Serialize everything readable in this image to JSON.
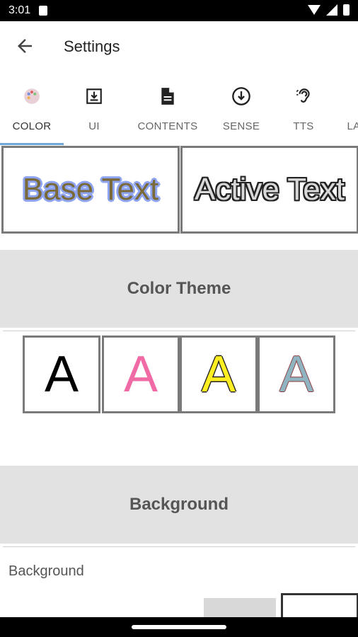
{
  "status": {
    "time": "3:01"
  },
  "app_bar": {
    "title": "Settings"
  },
  "tabs": [
    {
      "label": "COLOR",
      "icon": "palette-icon",
      "active": true
    },
    {
      "label": "UI",
      "icon": "download-box-icon",
      "active": false
    },
    {
      "label": "CONTENTS",
      "icon": "document-icon",
      "active": false
    },
    {
      "label": "SENSE",
      "icon": "down-circle-icon",
      "active": false
    },
    {
      "label": "TTS",
      "icon": "ear-icon",
      "active": false
    },
    {
      "label": "LA",
      "icon": "",
      "active": false
    }
  ],
  "preview": {
    "base_text": "Base Text",
    "active_text": "Active Text"
  },
  "sections": {
    "color_theme": "Color Theme",
    "background": "Background"
  },
  "themes": [
    {
      "letter": "A",
      "fill": "#000000",
      "outline": "#000000"
    },
    {
      "letter": "A",
      "fill": "#f06ba5",
      "outline": "#f06ba5"
    },
    {
      "letter": "A",
      "fill": "#ffee22",
      "outline": "#222222"
    },
    {
      "letter": "A",
      "fill": "#8fb3c0",
      "outline": "#8b3a3a"
    }
  ],
  "background": {
    "label": "Background"
  },
  "colors": {
    "tab_indicator": "#6ea7d8",
    "header_bg": "#e2e2e2"
  }
}
